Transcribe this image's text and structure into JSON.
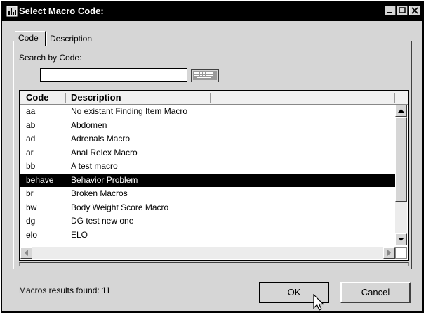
{
  "window": {
    "title": "Select Macro Code:"
  },
  "tabs": [
    {
      "label": "Code"
    },
    {
      "label": "Description"
    }
  ],
  "search": {
    "label": "Search by Code:",
    "value": ""
  },
  "list": {
    "columns": [
      "Code",
      "Description"
    ],
    "rows": [
      {
        "code": "aa",
        "description": "No existant Finding Item Macro"
      },
      {
        "code": "ab",
        "description": "Abdomen"
      },
      {
        "code": "ad",
        "description": "Adrenals Macro"
      },
      {
        "code": "ar",
        "description": "Anal Relex Macro"
      },
      {
        "code": "bb",
        "description": "A test macro"
      },
      {
        "code": "behave",
        "description": "Behavior Problem"
      },
      {
        "code": "br",
        "description": "Broken Macros"
      },
      {
        "code": "bw",
        "description": "Body Weight Score Macro"
      },
      {
        "code": "dg",
        "description": "DG test new one"
      },
      {
        "code": "elo",
        "description": "ELO"
      }
    ],
    "selected_code": "behave"
  },
  "status": {
    "text": "Macros results found:  11"
  },
  "buttons": {
    "ok": "OK",
    "cancel": "Cancel"
  }
}
